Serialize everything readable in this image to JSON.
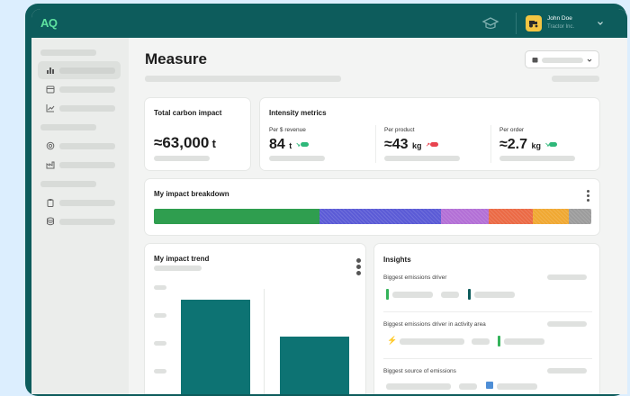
{
  "app": {
    "logo": "AQ"
  },
  "user": {
    "name": "John Doe",
    "org": "Tractor Inc."
  },
  "page": {
    "title": "Measure"
  },
  "total_carbon": {
    "title": "Total carbon impact",
    "value": "≈63,000",
    "unit": "t"
  },
  "intensity": {
    "title": "Intensity metrics",
    "metrics": [
      {
        "label": "Per $ revenue",
        "value": "84",
        "unit": "t",
        "trend": "down",
        "color": "#2fb87a"
      },
      {
        "label": "Per product",
        "value": "≈43",
        "unit": "kg",
        "trend": "up",
        "color": "#e8434f"
      },
      {
        "label": "Per order",
        "value": "≈2.7",
        "unit": "kg",
        "trend": "down",
        "color": "#2fb87a"
      }
    ]
  },
  "breakdown": {
    "title": "My impact breakdown",
    "segments": [
      {
        "share": 0.378,
        "color": "#2f9e4f"
      },
      {
        "share": 0.278,
        "color": "#5b5bd6"
      },
      {
        "share": 0.11,
        "color": "#b36fd6"
      },
      {
        "share": 0.1,
        "color": "#eb6a45"
      },
      {
        "share": 0.083,
        "color": "#f0a832"
      },
      {
        "share": 0.051,
        "color": "#9c9c9c"
      }
    ]
  },
  "trend": {
    "title": "My impact trend",
    "bar_color": "#0d7373"
  },
  "insights": {
    "title": "Insights",
    "items": [
      {
        "label": "Biggest emissions driver"
      },
      {
        "label": "Biggest emissions driver in activity area"
      },
      {
        "label": "Biggest source of emissions"
      }
    ]
  }
}
